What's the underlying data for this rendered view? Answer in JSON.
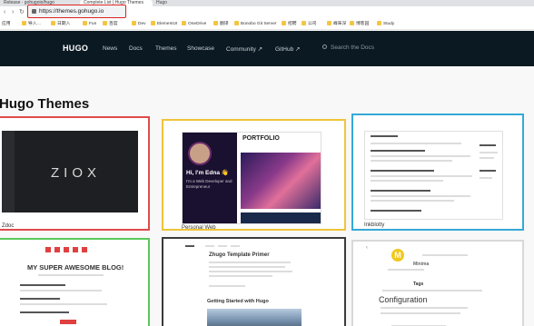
{
  "browser": {
    "tabs": [
      {
        "label": "Release · gohugoio/hugo"
      },
      {
        "label": "Complete List | Hugo Themes"
      },
      {
        "label": "Hugo"
      }
    ],
    "url": "https://themes.gohugo.io",
    "bookmarks": [
      "应用",
      "导入…",
      "日期入",
      "Fun",
      "百度",
      "Dev",
      "ElementUI",
      "OneDrive",
      "翻译",
      "Bonobo Git Server",
      "招聘",
      "公司",
      "峰味深",
      "博客园",
      "Study"
    ]
  },
  "site": {
    "logo": "HUGO",
    "nav": [
      "News",
      "Docs",
      "Themes",
      "Showcase",
      "Community ↗",
      "GitHub ↗"
    ],
    "search_placeholder": "Search the Docs"
  },
  "page": {
    "heading": "Hugo Themes"
  },
  "themes": [
    {
      "name": "Zdoc",
      "thumb_text": "ZIOX",
      "border": "#e04a4a"
    },
    {
      "name": "Personal Web",
      "thumb_title": "PORTFOLIO",
      "hero_text": "Hi, I'm Edna 👋",
      "hero_sub": "I'm a Web Developer and Entrepreneur",
      "border": "#f0c43a"
    },
    {
      "name": "Inkblotty",
      "border": "#36a9d8"
    },
    {
      "name": "",
      "thumb_title": "MY SUPER AWESOME BLOG!",
      "border": "#5bc85b"
    },
    {
      "name": "",
      "thumb_title": "Zhugo Template Primer",
      "thumb_sub": "Getting Started with Hugo",
      "border": "#3a3a3a"
    },
    {
      "name": "",
      "thumb_title": "Minima",
      "thumb_sub": "Configuration",
      "thumb_label": "Tags",
      "border": "#d8d8d8"
    }
  ]
}
